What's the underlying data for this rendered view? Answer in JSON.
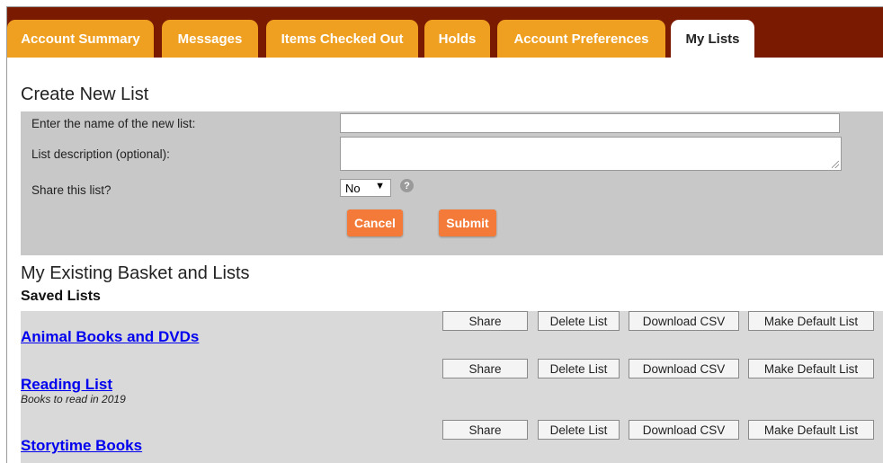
{
  "tabs": [
    {
      "label": "Account Summary"
    },
    {
      "label": "Messages"
    },
    {
      "label": "Items Checked Out"
    },
    {
      "label": "Holds"
    },
    {
      "label": "Account Preferences"
    },
    {
      "label": "My Lists",
      "active": true
    }
  ],
  "create": {
    "title": "Create New List",
    "name_label": "Enter the name of the new list:",
    "name_value": "",
    "description_label": "List description (optional):",
    "description_value": "",
    "share_label": "Share this list?",
    "share_value": "No",
    "help_icon": "?",
    "cancel_label": "Cancel",
    "submit_label": "Submit"
  },
  "existing": {
    "title": "My Existing Basket and Lists",
    "saved_heading": "Saved Lists",
    "button_labels": {
      "share": "Share",
      "delete": "Delete List",
      "download": "Download CSV",
      "default": "Make Default List"
    },
    "lists": [
      {
        "name": "Animal Books and DVDs",
        "description": ""
      },
      {
        "name": "Reading List",
        "description": "Books to read in 2019"
      },
      {
        "name": "Storytime Books",
        "description": ""
      }
    ]
  },
  "colors": {
    "tabbar_bg": "#7a1a00",
    "tab_bg": "#f0a020",
    "button_orange": "#f37a38",
    "panel_gray": "#c8c8c8",
    "link_blue": "#0000ee"
  }
}
